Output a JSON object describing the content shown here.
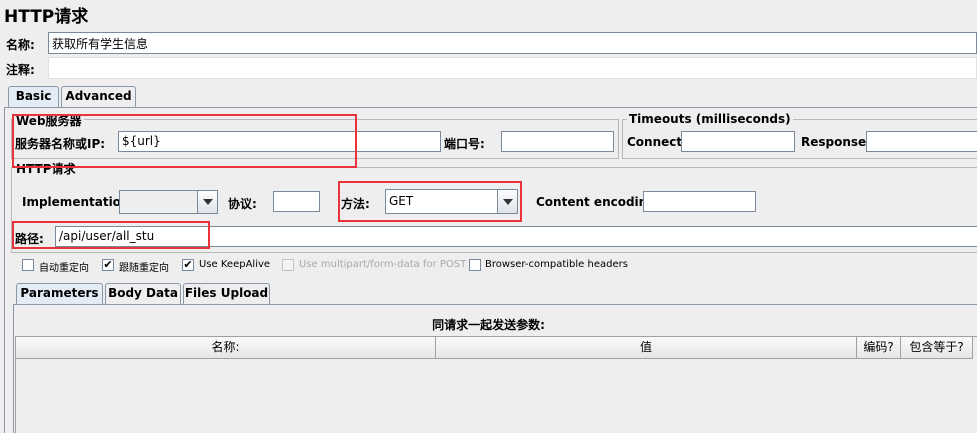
{
  "title": "HTTP请求",
  "name_label": "名称:",
  "name_value": "获取所有学生信息",
  "comment_label": "注释:",
  "comment_value": "",
  "tabs": [
    {
      "label": "Basic",
      "active": true
    },
    {
      "label": "Advanced",
      "active": false
    }
  ],
  "web_server": {
    "group_title": "Web服务器",
    "server_label": "服务器名称或IP:",
    "server_value": "${url}",
    "port_label": "端口号:",
    "port_value": ""
  },
  "timeouts": {
    "group_title": "Timeouts (milliseconds)",
    "connect_label": "Connect:",
    "connect_value": "",
    "response_label": "Response:",
    "response_value": ""
  },
  "http_request": {
    "group_title": "HTTP请求",
    "implementation_label": "Implementation:",
    "implementation_value": "",
    "protocol_label": "协议:",
    "protocol_value": "",
    "method_label": "方法:",
    "method_value": "GET",
    "encoding_label": "Content encoding:",
    "encoding_value": "",
    "path_label": "路径:",
    "path_value": "/api/user/all_stu"
  },
  "checkboxes": [
    {
      "label": "自动重定向",
      "checked": false,
      "disabled": false
    },
    {
      "label": "跟随重定向",
      "checked": true,
      "disabled": false
    },
    {
      "label": "Use KeepAlive",
      "checked": true,
      "disabled": false
    },
    {
      "label": "Use multipart/form-data for POST",
      "checked": false,
      "disabled": true
    },
    {
      "label": "Browser-compatible headers",
      "checked": false,
      "disabled": false
    }
  ],
  "sub_tabs": [
    {
      "label": "Parameters",
      "active": true
    },
    {
      "label": "Body Data",
      "active": false
    },
    {
      "label": "Files Upload",
      "active": false
    }
  ],
  "params": {
    "caption": "同请求一起发送参数:",
    "columns": [
      "名称:",
      "值",
      "编码?",
      "包含等于?"
    ]
  },
  "colors": {
    "highlight_border": "#e8323c",
    "panel_bg": "#eeeeee",
    "active_tab_bg": "#e3ecf5"
  }
}
